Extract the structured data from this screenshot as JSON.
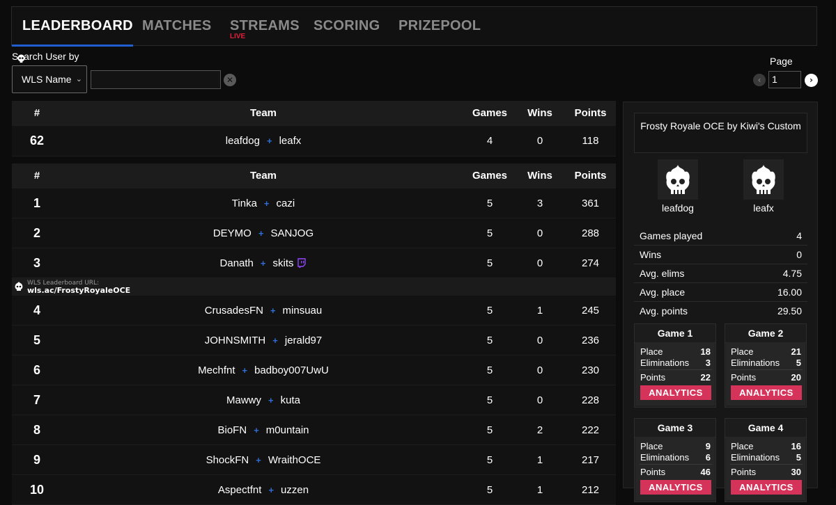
{
  "nav": {
    "tabs": [
      {
        "label": "LEADERBOARD"
      },
      {
        "label": "MATCHES"
      },
      {
        "label": "STREAMS",
        "badge": "LIVE"
      },
      {
        "label": "SCORING"
      },
      {
        "label": "PRIZEPOOL"
      }
    ]
  },
  "search": {
    "label": "Search User by",
    "select_value": "WLS Name",
    "input_value": "",
    "input_placeholder": ""
  },
  "pager": {
    "label": "Page",
    "value": "1"
  },
  "table": {
    "headers": {
      "rank": "#",
      "team": "Team",
      "games": "Games",
      "wins": "Wins",
      "points": "Points"
    },
    "highlight": {
      "rank": "62",
      "p1": "leafdog",
      "p2": "leafx",
      "games": "4",
      "wins": "0",
      "points": "118"
    },
    "rows": [
      {
        "rank": "1",
        "p1": "Tinka",
        "p2": "cazi",
        "games": "5",
        "wins": "3",
        "points": "361"
      },
      {
        "rank": "2",
        "p1": "DEYMO",
        "p2": "SANJOG",
        "games": "5",
        "wins": "0",
        "points": "288"
      },
      {
        "rank": "3",
        "p1": "Danath",
        "p2": "skits",
        "games": "5",
        "wins": "0",
        "points": "274"
      },
      {
        "rank": "4",
        "p1": "CrusadesFN",
        "p2": "minsuau",
        "games": "5",
        "wins": "1",
        "points": "245"
      },
      {
        "rank": "5",
        "p1": "JOHNSMITH",
        "p2": "jerald97",
        "games": "5",
        "wins": "0",
        "points": "236"
      },
      {
        "rank": "6",
        "p1": "Mechfnt",
        "p2": "badboy007UwU",
        "games": "5",
        "wins": "0",
        "points": "230"
      },
      {
        "rank": "7",
        "p1": "Mawwy",
        "p2": "kuta",
        "games": "5",
        "wins": "0",
        "points": "228"
      },
      {
        "rank": "8",
        "p1": "BioFN",
        "p2": "m0untain",
        "games": "5",
        "wins": "2",
        "points": "222"
      },
      {
        "rank": "9",
        "p1": "ShockFN",
        "p2": "WraithOCE",
        "games": "5",
        "wins": "1",
        "points": "217"
      },
      {
        "rank": "10",
        "p1": "Aspectfnt",
        "p2": "uzzen",
        "games": "5",
        "wins": "1",
        "points": "212"
      }
    ]
  },
  "banner": {
    "small": "WLS Leaderboard URL:",
    "url": "wls.ac/FrostyRoyaleOCE"
  },
  "panel": {
    "event": "Frosty Royale OCE by Kiwi's Custom",
    "players": [
      "leafdog",
      "leafx"
    ],
    "stats": [
      {
        "k": "Games played",
        "v": "4"
      },
      {
        "k": "Wins",
        "v": "0"
      },
      {
        "k": "Avg. elims",
        "v": "4.75"
      },
      {
        "k": "Avg. place",
        "v": "16.00"
      },
      {
        "k": "Avg. points",
        "v": "29.50"
      }
    ],
    "games": [
      {
        "title": "Game 1",
        "place_label": "Place",
        "place": "18",
        "elim_label": "Eliminations",
        "elims": "3",
        "points_label": "Points",
        "points": "22",
        "button": "ANALYTICS"
      },
      {
        "title": "Game 2",
        "place_label": "Place",
        "place": "21",
        "elim_label": "Eliminations",
        "elims": "5",
        "points_label": "Points",
        "points": "20",
        "button": "ANALYTICS"
      },
      {
        "title": "Game 3",
        "place_label": "Place",
        "place": "9",
        "elim_label": "Eliminations",
        "elims": "6",
        "points_label": "Points",
        "points": "46",
        "button": "ANALYTICS"
      },
      {
        "title": "Game 4",
        "place_label": "Place",
        "place": "16",
        "elim_label": "Eliminations",
        "elims": "5",
        "points_label": "Points",
        "points": "30",
        "button": "ANALYTICS"
      }
    ]
  },
  "colors": {
    "accent": "#1f5fd1",
    "live": "#e0203a",
    "analytics": "#d6335a",
    "plus": "#2f6ed8",
    "twitch": "#9146ff"
  },
  "icons": {
    "twitch": "twitch-icon",
    "skull": "skull-icon"
  }
}
